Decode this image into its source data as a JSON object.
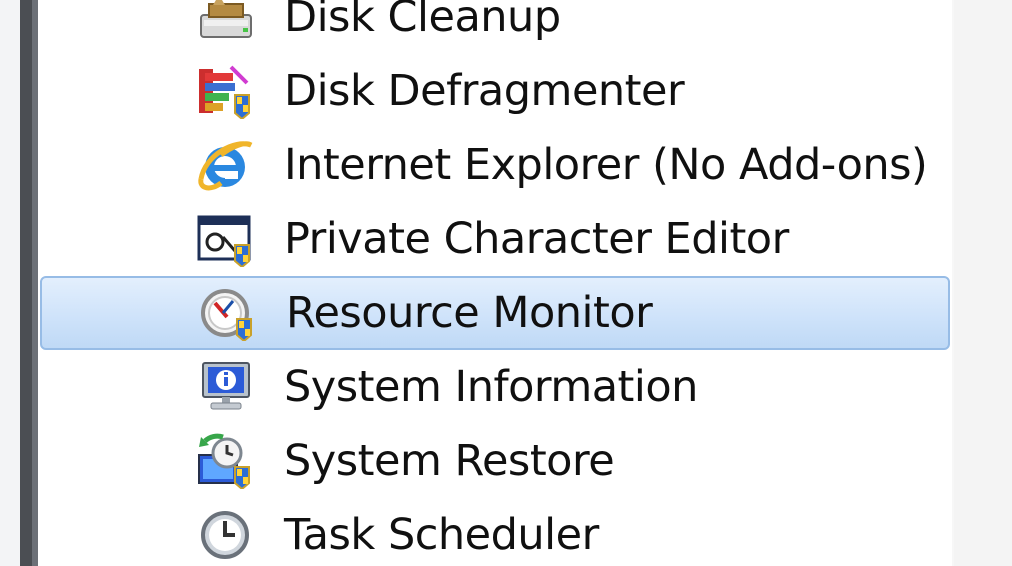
{
  "menu": {
    "items": [
      {
        "label": "Disk Cleanup",
        "icon": "disk-cleanup-icon",
        "selected": false
      },
      {
        "label": "Disk Defragmenter",
        "icon": "disk-defragmenter-icon",
        "selected": false
      },
      {
        "label": "Internet Explorer (No Add-ons)",
        "icon": "internet-explorer-icon",
        "selected": false
      },
      {
        "label": "Private Character Editor",
        "icon": "private-character-editor-icon",
        "selected": false
      },
      {
        "label": "Resource Monitor",
        "icon": "resource-monitor-icon",
        "selected": true
      },
      {
        "label": "System Information",
        "icon": "system-information-icon",
        "selected": false
      },
      {
        "label": "System Restore",
        "icon": "system-restore-icon",
        "selected": false
      },
      {
        "label": "Task Scheduler",
        "icon": "task-scheduler-icon",
        "selected": false
      }
    ]
  },
  "colors": {
    "selection_border": "#97bce6",
    "selection_fill": "#cfe3fa",
    "text": "#101010",
    "left_border": "#4b4e53",
    "right_panel": "#f4f4f4"
  }
}
